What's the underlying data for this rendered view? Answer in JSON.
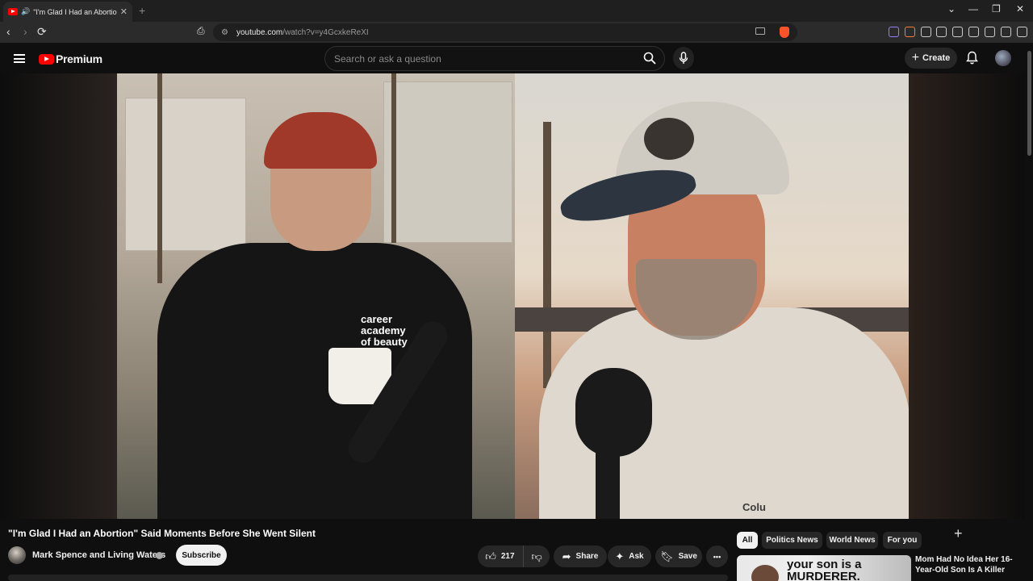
{
  "browser": {
    "tab_title": "\"I'm Glad I Had an Abortion\"",
    "url_host": "youtube.com",
    "url_path": "/watch?v=y4GcxkeReXI",
    "window_controls": [
      "⌄",
      "—",
      "❐",
      "✕"
    ]
  },
  "header": {
    "logo_text": "Premium",
    "search_placeholder": "Search or ask a question",
    "create_label": "Create"
  },
  "video": {
    "title": "\"I'm Glad I Had an Abortion\" Said Moments Before She Went Silent",
    "shirt_text": "career academy of beauty",
    "jacket_brand": "Colu"
  },
  "channel": {
    "name": "Mark Spence and Living Waters",
    "subscribe_label": "Subscribe"
  },
  "actions": {
    "like_count": "217",
    "share_label": "Share",
    "ask_label": "Ask",
    "save_label": "Save",
    "more_label": "•••"
  },
  "chips": [
    {
      "label": "All",
      "active": true
    },
    {
      "label": "Politics News",
      "active": false
    },
    {
      "label": "World News",
      "active": false
    },
    {
      "label": "For you",
      "active": false
    }
  ],
  "recommendation": {
    "title": "Mom Had No Idea Her 16-Year-Old Son Is A Killer",
    "thumb_text": "your son is a MURDERER."
  },
  "colors": {
    "brand_red": "#ff0000",
    "background": "#0f0f0f",
    "pill_bg": "#272727"
  }
}
